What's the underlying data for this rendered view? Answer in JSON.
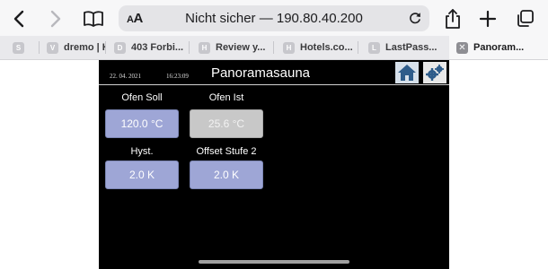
{
  "browser": {
    "text_size_label_small": "A",
    "text_size_label_large": "A",
    "address": {
      "security": "Nicht sicher",
      "separator": " — ",
      "host": "190.80.40.200"
    }
  },
  "tabs": [
    {
      "favicon": "S",
      "title": ""
    },
    {
      "favicon": "V",
      "title": "dremo | K"
    },
    {
      "favicon": "D",
      "title": "403 Forbi..."
    },
    {
      "favicon": "H",
      "title": "Review y..."
    },
    {
      "favicon": "H",
      "title": "Hotels.co..."
    },
    {
      "favicon": "L",
      "title": "LastPass..."
    },
    {
      "favicon": "✕",
      "title": "Panoram...",
      "active": true
    }
  ],
  "app": {
    "date": "22. 04. 2021",
    "time": "16:23:09",
    "title": "Panoramasauna",
    "fields": {
      "ofen_soll": {
        "label": "Ofen Soll",
        "value": "120.0 °C"
      },
      "ofen_ist": {
        "label": "Ofen Ist",
        "value": "25.6 °C"
      },
      "hyst": {
        "label": "Hyst.",
        "value": "2.0 K"
      },
      "offset": {
        "label": "Offset Stufe 2",
        "value": "2.0 K"
      }
    }
  },
  "colors": {
    "app_background": "#000000",
    "editable_box": "#9ea6d6",
    "readonly_box": "#c8c8c8"
  },
  "icons": [
    "chevron-left-icon",
    "chevron-right-icon",
    "book-icon",
    "reload-icon",
    "share-icon",
    "plus-icon",
    "tabs-overview-icon",
    "home-icon",
    "settings-gears-icon"
  ]
}
